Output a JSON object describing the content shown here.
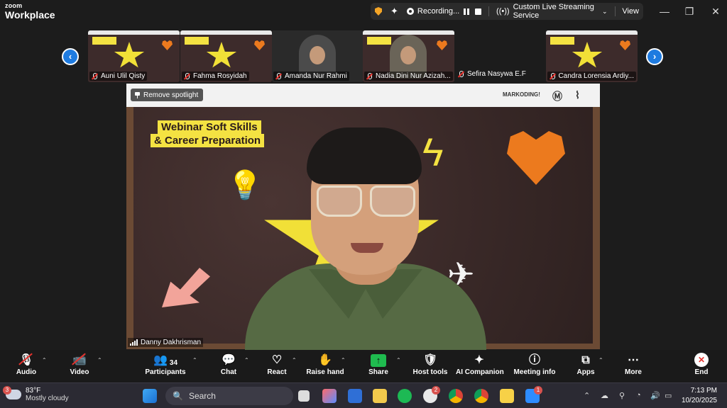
{
  "app": {
    "brand_top": "zoom",
    "brand_bottom": "Workplace"
  },
  "status_bar": {
    "recording": "Recording...",
    "streaming": "Custom Live Streaming Service",
    "view": "View"
  },
  "thumbnails": [
    {
      "name": "Auni Ulil Qisty",
      "type": "slide"
    },
    {
      "name": "Fahma Rosyidah",
      "type": "slide"
    },
    {
      "name": "Amanda Nur Rahmi",
      "type": "camera"
    },
    {
      "name": "Nadia Dini Nur Azizah...",
      "type": "camera-slide"
    },
    {
      "name": "Sefira Nasywa E.F",
      "type": "none"
    },
    {
      "name": "Candra Lorensia Ardiy...",
      "type": "slide"
    }
  ],
  "spotlight": {
    "remove_label": "Remove spotlight",
    "speaker_name": "Danny Dakhrisman",
    "slide_title_line1": "Webinar Soft Skills",
    "slide_title_line2": "& Career Preparation",
    "logo_text": "MARKODING!"
  },
  "toolbar": {
    "audio": "Audio",
    "video": "Video",
    "participants": "Participants",
    "participants_count": "34",
    "chat": "Chat",
    "react": "React",
    "raise_hand": "Raise hand",
    "share": "Share",
    "host_tools": "Host tools",
    "ai_companion": "AI Companion",
    "meeting_info": "Meeting info",
    "apps": "Apps",
    "more": "More",
    "end": "End"
  },
  "taskbar": {
    "weather_temp": "83°F",
    "weather_condition": "Mostly cloudy",
    "weather_badge": "3",
    "search_placeholder": "Search",
    "time": "7:13 PM",
    "date": "10/20/2025",
    "chrome_badge": "2",
    "app_badge": "1"
  },
  "colors": {
    "accent_blue": "#1e7be0",
    "share_green": "#1fbb4f",
    "end_red": "#e5322d",
    "slide_yellow": "#f4e242",
    "heart_orange": "#ec7a1e"
  }
}
